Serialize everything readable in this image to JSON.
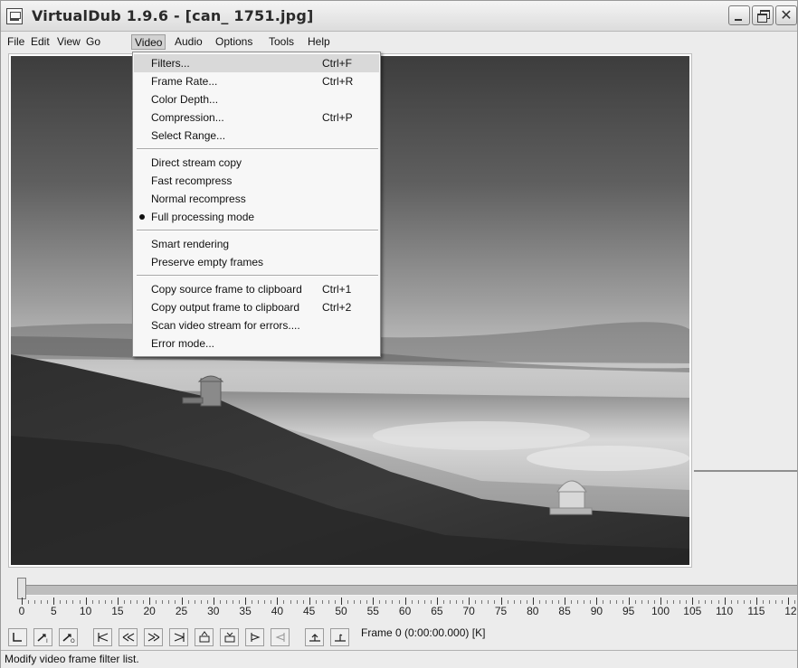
{
  "window": {
    "title": "VirtualDub 1.9.6 - [can_ 1751.jpg]",
    "icons": [
      "app-icon",
      "minimize-icon",
      "maximize-icon",
      "close-icon"
    ]
  },
  "menubar": {
    "items": [
      "File",
      "Edit",
      "View",
      "Go",
      "Video",
      "Audio",
      "Options",
      "Tools",
      "Help"
    ],
    "open_menu": "Video"
  },
  "video_menu": {
    "groups": [
      [
        {
          "label": "Filters...",
          "shortcut": "Ctrl+F",
          "highlighted": true
        },
        {
          "label": "Frame Rate...",
          "shortcut": "Ctrl+R"
        },
        {
          "label": "Color Depth...",
          "shortcut": ""
        },
        {
          "label": "Compression...",
          "shortcut": "Ctrl+P"
        },
        {
          "label": "Select Range...",
          "shortcut": ""
        }
      ],
      [
        {
          "label": "Direct stream copy",
          "shortcut": ""
        },
        {
          "label": "Fast recompress",
          "shortcut": ""
        },
        {
          "label": "Normal recompress",
          "shortcut": ""
        },
        {
          "label": "Full processing mode",
          "shortcut": "",
          "checked": true
        }
      ],
      [
        {
          "label": "Smart rendering",
          "shortcut": ""
        },
        {
          "label": "Preserve empty frames",
          "shortcut": ""
        }
      ],
      [
        {
          "label": "Copy source frame to clipboard",
          "shortcut": "Ctrl+1"
        },
        {
          "label": "Copy output frame to clipboard",
          "shortcut": "Ctrl+2"
        },
        {
          "label": "Scan video stream for errors....",
          "shortcut": ""
        },
        {
          "label": "Error mode...",
          "shortcut": ""
        }
      ]
    ]
  },
  "timeline": {
    "labels": [
      "0",
      "5",
      "10",
      "15",
      "20",
      "25",
      "30",
      "35",
      "40",
      "45",
      "50",
      "55",
      "60",
      "65",
      "70",
      "75",
      "80",
      "85",
      "90",
      "95",
      "100",
      "105",
      "110",
      "115",
      "12"
    ],
    "current_position": 0
  },
  "toolbar": {
    "buttons": [
      "stop-icon",
      "play-input-icon",
      "play-output-icon",
      "start-icon",
      "previous-frame-icon",
      "next-frame-icon",
      "end-icon",
      "previous-keyframe-icon",
      "next-keyframe-icon",
      "scene-back-icon",
      "scene-forward-icon",
      "mark-in-icon",
      "mark-out-icon"
    ],
    "frame_readout": "Frame 0 (0:00:00.000) [K]"
  },
  "statusbar": {
    "text": "Modify video frame filter list."
  }
}
